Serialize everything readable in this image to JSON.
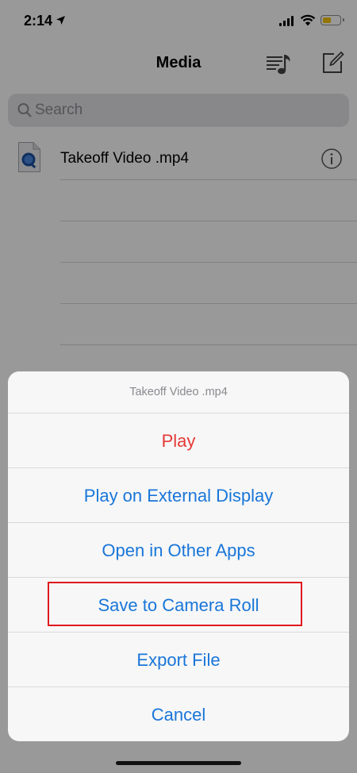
{
  "status_bar": {
    "time": "2:14"
  },
  "nav": {
    "title": "Media"
  },
  "search": {
    "placeholder": "Search"
  },
  "files": [
    {
      "name": "Takeoff Video .mp4"
    }
  ],
  "action_sheet": {
    "title": "Takeoff Video .mp4",
    "actions": [
      {
        "label": "Play",
        "style": "destructive"
      },
      {
        "label": "Play on External Display",
        "style": "default"
      },
      {
        "label": "Open in Other Apps",
        "style": "default"
      },
      {
        "label": "Save to Camera Roll",
        "style": "default",
        "highlighted": true
      },
      {
        "label": "Export File",
        "style": "default"
      },
      {
        "label": "Cancel",
        "style": "cancel"
      }
    ]
  },
  "colors": {
    "accent": "#1976d8",
    "destructive": "#e53935",
    "highlight_box": "#e0191e",
    "battery": "#f5c400"
  },
  "icons": [
    "location-arrow-icon",
    "signal-icon",
    "wifi-icon",
    "battery-icon",
    "playlist-icon",
    "compose-icon",
    "search-icon",
    "video-file-icon",
    "info-icon"
  ]
}
